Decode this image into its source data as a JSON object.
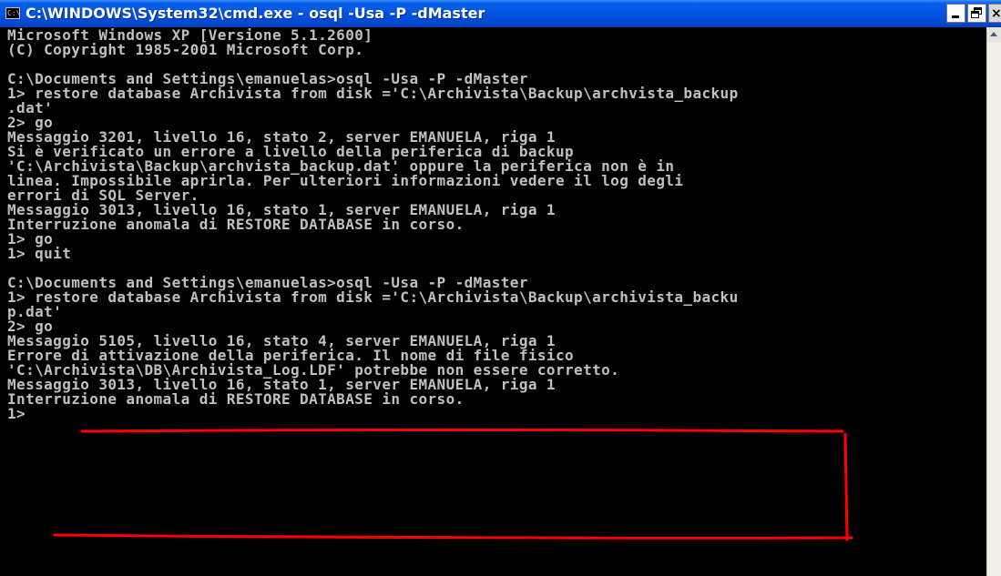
{
  "window": {
    "title": "C:\\WINDOWS\\System32\\cmd.exe - osql -Usa -P -dMaster",
    "icon_glyph": "C:\\",
    "buttons": [
      "minimize",
      "maximize",
      "close"
    ],
    "close_glyph": "×"
  },
  "console": {
    "lines": [
      "Microsoft Windows XP [Versione 5.1.2600]",
      "(C) Copyright 1985-2001 Microsoft Corp.",
      "",
      "C:\\Documents and Settings\\emanuelas>osql -Usa -P -dMaster",
      "1> restore database Archivista from disk ='C:\\Archivista\\Backup\\archvista_backup",
      ".dat'",
      "2> go",
      "Messaggio 3201, livello 16, stato 2, server EMANUELA, riga 1",
      "Si è verificato un errore a livello della periferica di backup",
      "'C:\\Archivista\\Backup\\archvista_backup.dat' oppure la periferica non è in",
      "linea. Impossibile aprirla. Per ulteriori informazioni vedere il log degli",
      "errori di SQL Server.",
      "Messaggio 3013, livello 16, stato 1, server EMANUELA, riga 1",
      "Interruzione anomala di RESTORE DATABASE in corso.",
      "1> go",
      "1> quit",
      "",
      "C:\\Documents and Settings\\emanuelas>osql -Usa -P -dMaster",
      "1> restore database Archivista from disk ='C:\\Archivista\\Backup\\archivista_backu",
      "p.dat'",
      "2> go",
      "Messaggio 5105, livello 16, stato 4, server EMANUELA, riga 1",
      "Errore di attivazione della periferica. Il nome di file fisico",
      "'C:\\Archivista\\DB\\Archivista_Log.LDF' potrebbe non essere corretto.",
      "Messaggio 3013, livello 16, stato 1, server EMANUELA, riga 1",
      "Interruzione anomala di RESTORE DATABASE in corso.",
      "1>"
    ]
  },
  "colors": {
    "console_text": "#c0c0c0",
    "console_bg": "#000000",
    "titlebar": "#0054e3",
    "annotation": "#ff0000"
  }
}
